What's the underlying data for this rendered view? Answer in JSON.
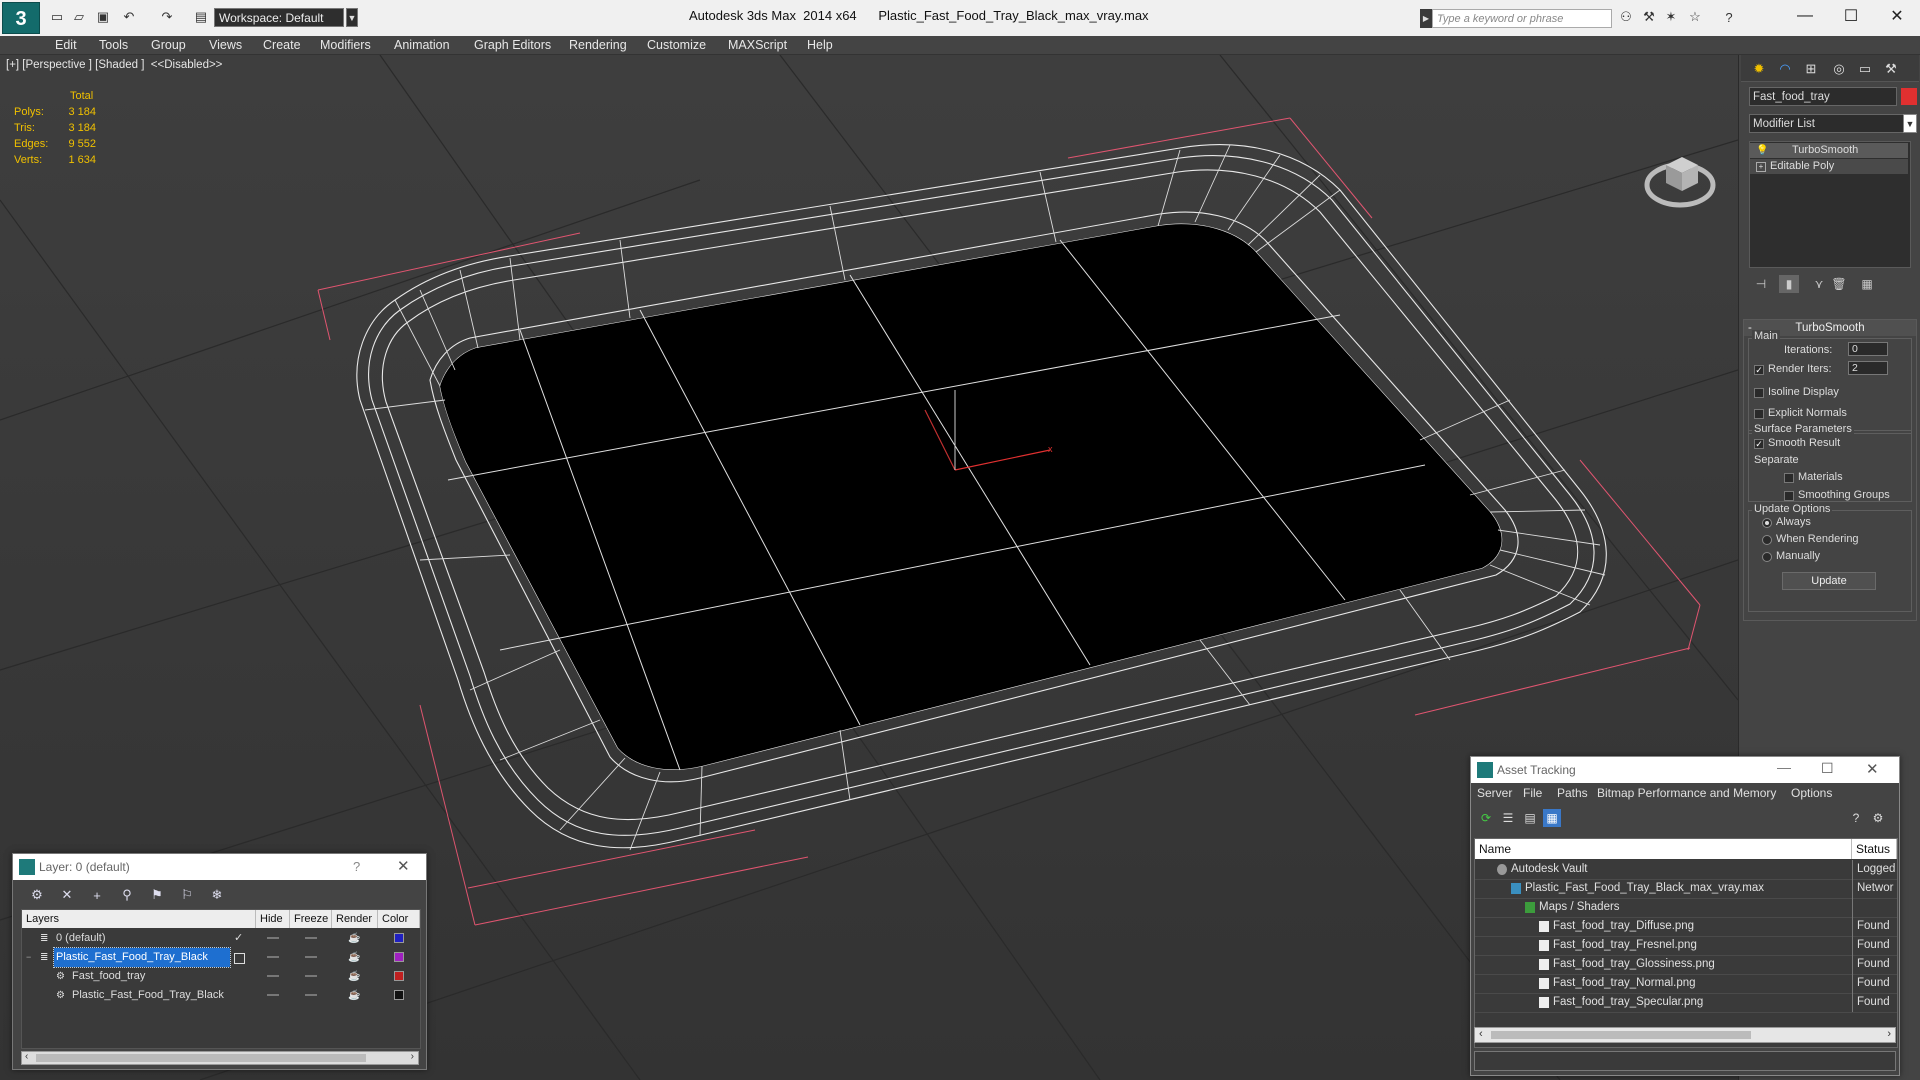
{
  "titlebar": {
    "app_title": "Autodesk 3ds Max  2014 x64",
    "file_title": "Plastic_Fast_Food_Tray_Black_max_vray.max",
    "workspace": "Workspace: Default",
    "search_placeholder": "Type a keyword or phrase"
  },
  "menu": [
    "Edit",
    "Tools",
    "Group",
    "Views",
    "Create",
    "Modifiers",
    "Animation",
    "Graph Editors",
    "Rendering",
    "Customize",
    "MAXScript",
    "Help"
  ],
  "viewport": {
    "label": "[+] [Perspective ] [Shaded ]  <<Disabled>>",
    "stats": {
      "header": "Total",
      "rows": [
        {
          "label": "Polys:",
          "value": "3 184"
        },
        {
          "label": "Tris:",
          "value": "3 184"
        },
        {
          "label": "Edges:",
          "value": "9 552"
        },
        {
          "label": "Verts:",
          "value": "1 634"
        }
      ]
    }
  },
  "command_panel": {
    "object_name": "Fast_food_tray",
    "object_color": "#e03030",
    "modifier_list": "Modifier List",
    "stack": [
      "TurboSmooth",
      "Editable Poly"
    ],
    "rollout": {
      "title": "TurboSmooth",
      "main_label": "Main",
      "iterations_label": "Iterations:",
      "iterations_value": "0",
      "render_iters_label": "Render Iters:",
      "render_iters_value": "2",
      "isoline": "Isoline Display",
      "explicit_normals": "Explicit Normals",
      "surface_params": "Surface Parameters",
      "smooth_result": "Smooth Result",
      "separate": "Separate",
      "materials": "Materials",
      "smoothing_groups": "Smoothing Groups",
      "update_options": "Update Options",
      "always": "Always",
      "when_rendering": "When Rendering",
      "manually": "Manually",
      "update_btn": "Update"
    }
  },
  "layer_dialog": {
    "title": "Layer: 0 (default)",
    "help": "?",
    "columns": [
      "Layers",
      "Hide",
      "Freeze",
      "Render",
      "Color"
    ],
    "rows": [
      {
        "name": "0 (default)",
        "color": "#2020c0",
        "selected": false,
        "indent": 1
      },
      {
        "name": "Plastic_Fast_Food_Tray_Black",
        "color": "#a020c0",
        "selected": true,
        "indent": 1
      },
      {
        "name": "Fast_food_tray",
        "color": "#c02020",
        "selected": false,
        "indent": 2
      },
      {
        "name": "Plastic_Fast_Food_Tray_Black",
        "color": "#111111",
        "selected": false,
        "indent": 2
      }
    ]
  },
  "asset_dialog": {
    "title": "Asset Tracking",
    "menu": [
      "Server",
      "File",
      "Paths",
      "Bitmap Performance and Memory",
      "Options"
    ],
    "columns": [
      "Name",
      "Status"
    ],
    "rows": [
      {
        "name": "Autodesk Vault",
        "status": "Logged",
        "indent": 1
      },
      {
        "name": "Plastic_Fast_Food_Tray_Black_max_vray.max",
        "status": "Networ",
        "indent": 2
      },
      {
        "name": "Maps / Shaders",
        "status": "",
        "indent": 3
      },
      {
        "name": "Fast_food_tray_Diffuse.png",
        "status": "Found",
        "indent": 4
      },
      {
        "name": "Fast_food_tray_Fresnel.png",
        "status": "Found",
        "indent": 4
      },
      {
        "name": "Fast_food_tray_Glossiness.png",
        "status": "Found",
        "indent": 4
      },
      {
        "name": "Fast_food_tray_Normal.png",
        "status": "Found",
        "indent": 4
      },
      {
        "name": "Fast_food_tray_Specular.png",
        "status": "Found",
        "indent": 4
      }
    ]
  },
  "icons": {
    "app_logo": "3ds-max-logo",
    "minimize": "minimize-icon",
    "maximize": "maximize-icon",
    "close": "close-icon"
  }
}
